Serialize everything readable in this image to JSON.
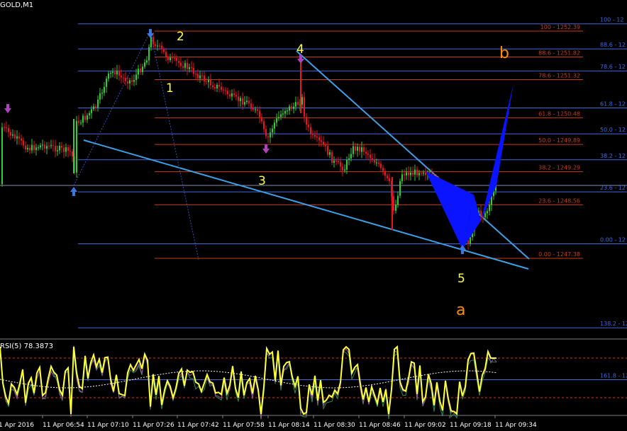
{
  "symbol_label": "GOLD,M1",
  "rsi_label": "RSI(5) 78.3873",
  "colors": {
    "background": "#000000",
    "bull": "#32CD32",
    "bear": "#E8141E",
    "blue_level": "#4169E1",
    "red_level": "#C83C14",
    "trend": "#3CA0E6",
    "pattern": "#0A14FF",
    "wave_yellow": "#FFFF3C",
    "wave_orange": "#FF8C00"
  },
  "chart_data": {
    "type": "candlestick",
    "symbol": "GOLD",
    "timeframe": "M1",
    "x_tick_labels": [
      "1 Apr 2016",
      "11 Apr 06:54",
      "11 Apr 07:10",
      "11 Apr 07:26",
      "11 Apr 07:42",
      "11 Apr 07:58",
      "11 Apr 08:14",
      "11 Apr 08:30",
      "11 Apr 08:46",
      "11 Apr 09:02",
      "11 Apr 09:18",
      "11 Apr 09:34"
    ],
    "fib_levels_right": [
      {
        "label": "100 - 1252.39",
        "level": 100,
        "price": 1252.39
      },
      {
        "label": "88.6 - 1251.82",
        "level": 88.6,
        "price": 1251.82
      },
      {
        "label": "78.6 - 1251.32",
        "level": 78.6,
        "price": 1251.32
      },
      {
        "label": "61.8 - 1250.48",
        "level": 61.8,
        "price": 1250.48
      },
      {
        "label": "50.0 - 1249.89",
        "level": 50.0,
        "price": 1249.89
      },
      {
        "label": "38.2 - 1249.29",
        "level": 38.2,
        "price": 1249.29
      },
      {
        "label": "23.6 - 1248.56",
        "level": 23.6,
        "price": 1248.56
      },
      {
        "label": "0.00 - 1247.38",
        "level": 0.0,
        "price": 1247.38
      }
    ],
    "fib_levels_edge": [
      "0.00 - 12",
      "23.6 - 12",
      "38.2 - 12",
      "50.0 - 12",
      "61.8 - 12",
      "78.6 - 12",
      "88.6 - 12",
      "100 - 12",
      "138.2 - 12",
      "161.8 - 12"
    ],
    "wave_labels": [
      "2",
      "1",
      "4",
      "3",
      "5",
      "b",
      "a"
    ],
    "rsi": {
      "period": 5,
      "value": 78.3873,
      "levels_dashed": [
        70,
        30
      ]
    }
  }
}
